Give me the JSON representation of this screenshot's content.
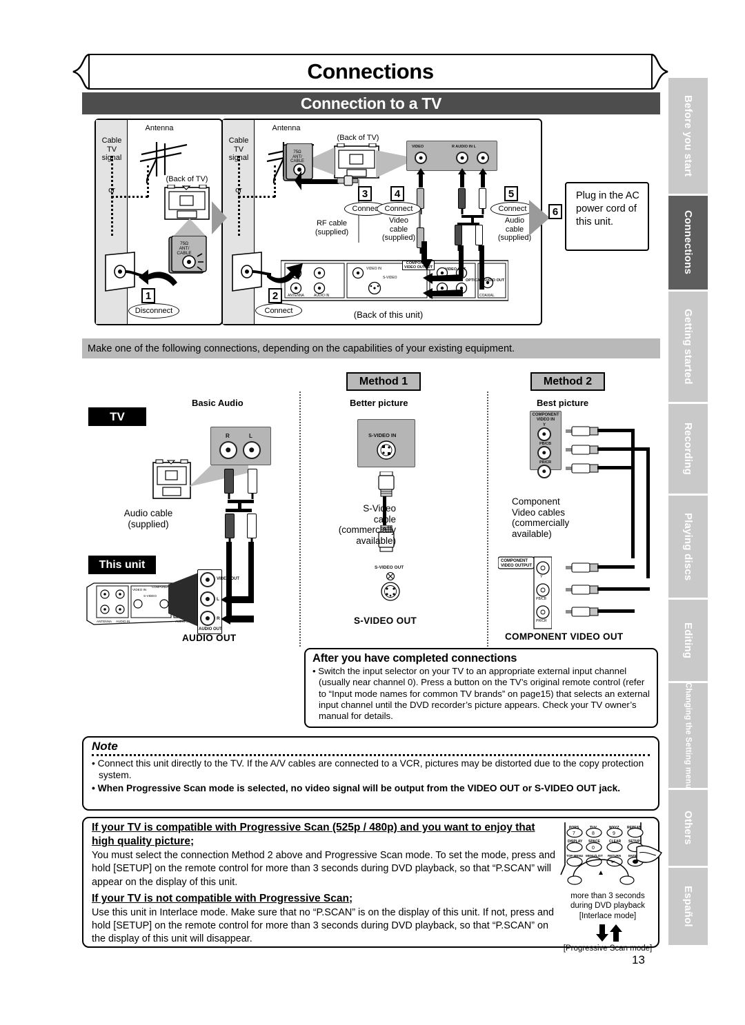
{
  "header": {
    "chapter_title": "Connections",
    "section_title": "Connection to a TV"
  },
  "side_tabs": [
    {
      "label": "Before you start",
      "active": false
    },
    {
      "label": "Connections",
      "active": true
    },
    {
      "label": "Getting started",
      "active": false
    },
    {
      "label": "Recording",
      "active": false
    },
    {
      "label": "Playing discs",
      "active": false
    },
    {
      "label": "Editing",
      "active": false
    },
    {
      "label": "Changing the Setting menu",
      "active": false
    },
    {
      "label": "Others",
      "active": false
    },
    {
      "label": "Español",
      "active": false
    }
  ],
  "diagram": {
    "panel1": {
      "cable_tv_signal": "Cable\nTV signal",
      "antenna": "Antenna",
      "or": "or",
      "back_of_tv": "(Back of TV)",
      "jack_label": "75Ω\nANT/\nCABLE",
      "step": "1",
      "action": "Disconnect"
    },
    "panel2": {
      "cable_tv_signal": "Cable\nTV signal",
      "antenna": "Antenna",
      "or": "or",
      "back_of_tv": "(Back of TV)",
      "jack_label": "75Ω\nANT/\nCABLE",
      "step2": "2",
      "action2": "Connect",
      "step3": "3",
      "action3": "Connect",
      "rf_cable": "RF cable\n(supplied)",
      "step4": "4",
      "action4": "Connect",
      "video_cable": "Video\ncable\n(supplied)",
      "step5": "5",
      "action5": "Connect",
      "audio_cable": "Audio\ncable\n(supplied)",
      "tv_jacks": [
        "VIDEO",
        "AUDIO IN",
        "R",
        "L"
      ],
      "back_of_unit": "(Back of this unit)",
      "unit_jack_labels": [
        "ANTENNA",
        "AUDIO IN",
        "VIDEO IN",
        "S-VIDEO",
        "COMPONENT VIDEO OUTPUT",
        "VIDEO OUT",
        "AUDIO OUT",
        "COAXIAL",
        "OPTICAL AUDIO OUT",
        "IN",
        "OUT"
      ]
    },
    "ac_step": "6",
    "ac_text": "Plug in the AC power cord of this unit."
  },
  "instruction_bar": "Make one of the following connections, depending on the capabilities of your existing equipment.",
  "methods": {
    "method1_label": "Method 1",
    "method2_label": "Method 2",
    "col1_head": "Basic Audio",
    "col2_head": "Better picture",
    "col3_head": "Best picture",
    "tv_chip": "TV",
    "unit_chip": "This unit",
    "col1": {
      "jack_r": "R",
      "jack_l": "L",
      "cable_label": "Audio cable\n(supplied)",
      "unit_jack_video_out": "VIDEO OUT",
      "unit_jack_audio_out": "AUDIO OUT",
      "unit_jack_l": "L",
      "unit_jack_r": "R",
      "caption": "AUDIO OUT"
    },
    "col2": {
      "tv_jack": "S-VIDEO IN",
      "cable_label": "S-Video\ncable\n(commercially\navailable)",
      "unit_jack": "S-VIDEO OUT",
      "caption": "S-VIDEO OUT"
    },
    "col3": {
      "tv_jack_title": "COMPONENT\nVIDEO IN",
      "tv_jacks": [
        "Y",
        "PB/CB",
        "PR/CR"
      ],
      "cable_label": "Component\nVideo cables\n(commercially\navailable)",
      "unit_jack_title": "COMPONENT\nVIDEO OUTPUT",
      "unit_jacks": [
        "Y",
        "PB/CB",
        "PR/CR"
      ],
      "caption": "COMPONENT VIDEO OUT"
    }
  },
  "after_connections": {
    "title": "After you have completed connections",
    "body": "• Switch the input selector on your TV to an appropriate external input channel (usually near channel 0). Press a button on the TV’s original remote control (refer to “Input mode names for common TV brands” on page15) that selects an external input channel until the DVD recorder’s picture appears. Check your TV owner’s manual for details."
  },
  "note": {
    "title": "Note",
    "items": [
      {
        "text": "• Connect this unit directly to the TV. If the A/V cables are connected to a VCR, pictures may be distorted due to the copy protection system.",
        "bold": false
      },
      {
        "text": "• When Progressive Scan mode is selected, no video signal will be output from the VIDEO OUT or S-VIDEO OUT jack.",
        "bold": true
      }
    ]
  },
  "progressive": {
    "head1": "If your TV is compatible with Progressive Scan (525p / 480p) and you want to enjoy that high quality picture;",
    "body1": "You must select the connection Method 2 above and Progressive Scan mode. To set the mode, press and hold [SETUP] on the remote control for more than 3 seconds during DVD playback, so that “P.SCAN” will appear on the display of this unit.",
    "head2": "If your TV is not compatible with Progressive Scan;",
    "body2": "Use this unit in Interlace mode. Make sure that no “P.SCAN” is on the display of this unit. If not, press and hold [SETUP] on the remote control for more than 3 seconds during DVD playback, so that “P.SCAN” on the display of this unit will disappear.",
    "remote_buttons": [
      [
        "PQRS",
        "TUV",
        "WXYZ",
        "REPEAT"
      ],
      [
        "7",
        "8",
        "9",
        ""
      ],
      [
        "DISPLAY",
        "SPACE",
        "CLEAR",
        "SETUP"
      ],
      [
        "",
        "0",
        "",
        ""
      ],
      [
        "TOP MENU",
        "MENU/LIST",
        "RETURN",
        "ENTER"
      ]
    ],
    "caption1": "more than 3 seconds",
    "caption2": "during DVD playback",
    "caption3": "[Interlace mode]",
    "caption4": "[Progressive Scan mode]"
  },
  "page_number": "13"
}
